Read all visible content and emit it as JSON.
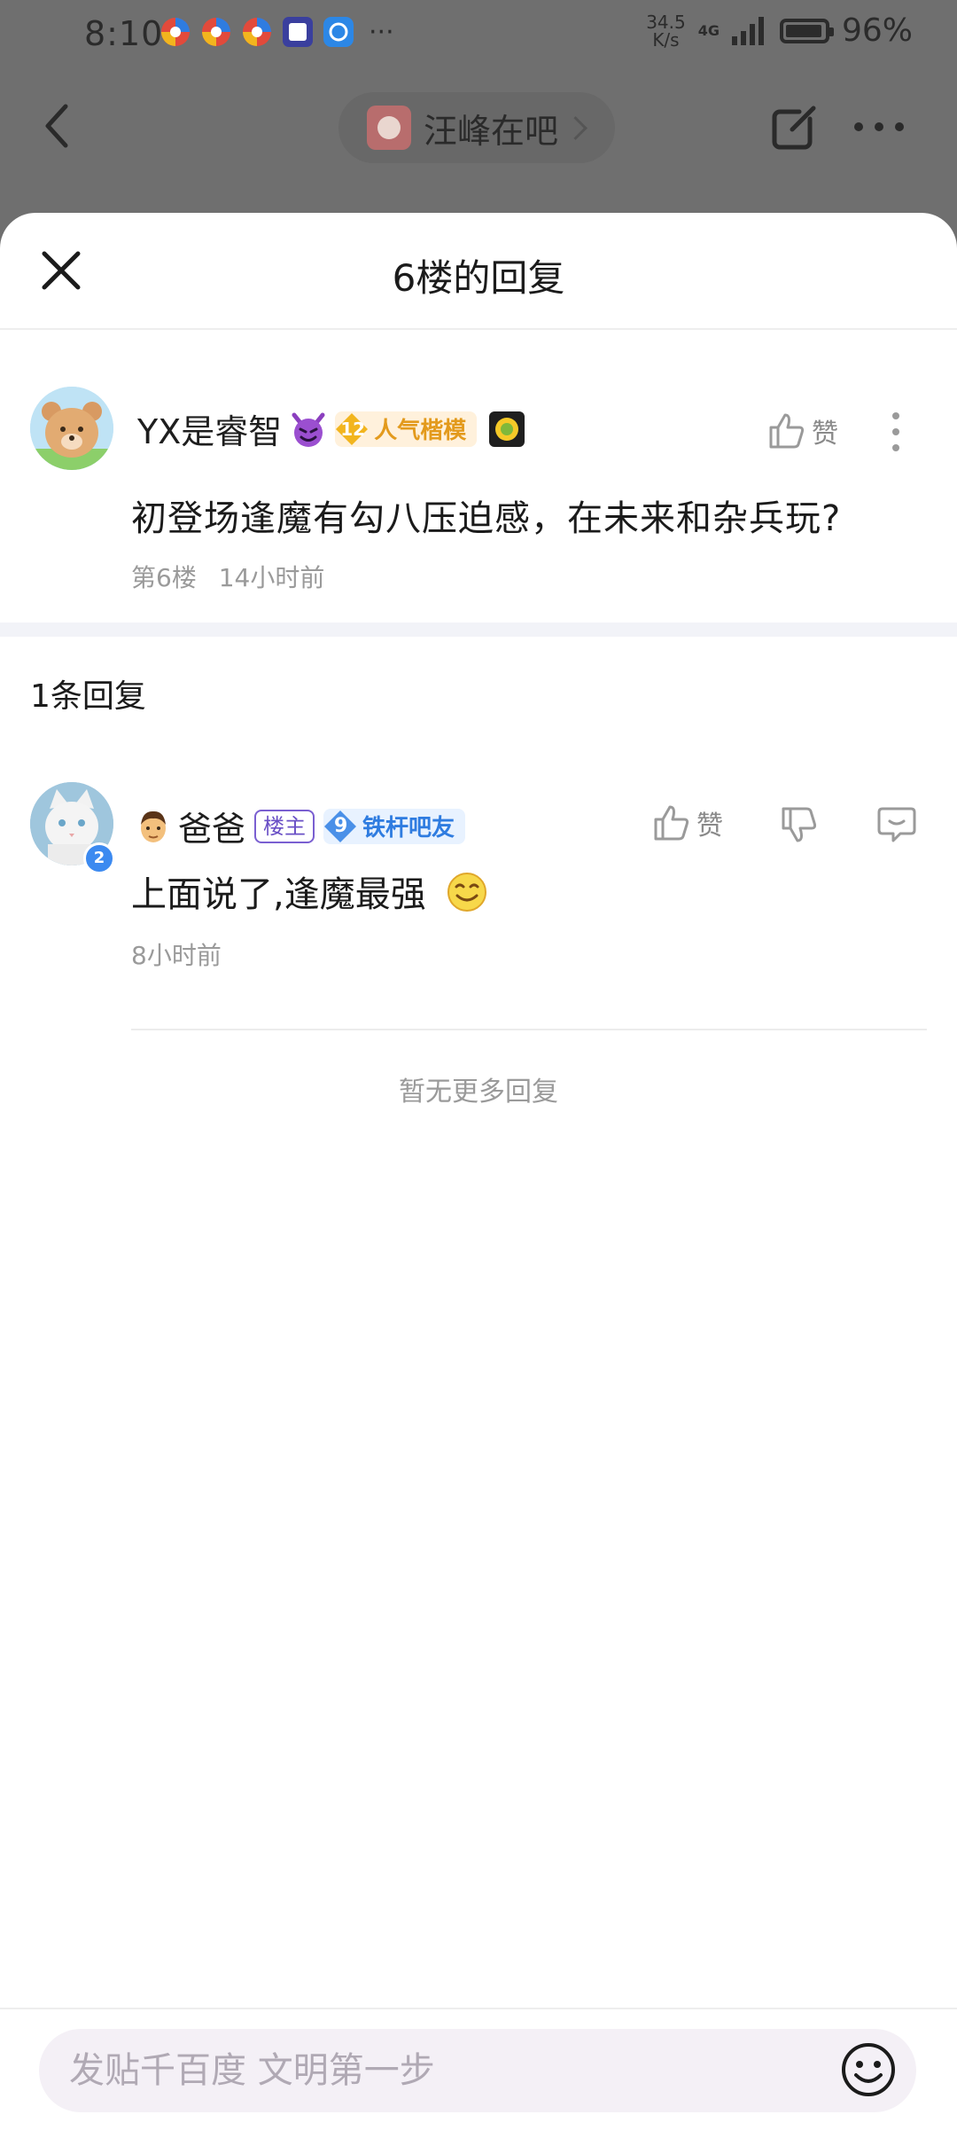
{
  "status_bar": {
    "time": "8:10",
    "net_speed_top": "34.5",
    "net_speed_bottom": "K/s",
    "network": "4G",
    "battery_percent": "96%",
    "battery_level": 0.96
  },
  "nav": {
    "forum_name": "汪峰在吧"
  },
  "sheet": {
    "title": "6楼的回复"
  },
  "post": {
    "username": "YX是睿智",
    "level": "12",
    "badge": "人气楷模",
    "like_label": "赞",
    "content": "初登场逢魔有勾八压迫感，在未来和杂兵玩?",
    "floor": "第6楼",
    "time": "14小时前"
  },
  "replies": {
    "count_label": "1条回复",
    "items": [
      {
        "username": "爸爸",
        "owner_badge": "楼主",
        "level": "9",
        "badge": "铁杆吧友",
        "avatar_level": "2",
        "like_label": "赞",
        "content": "上面说了,逢魔最强",
        "time": "8小时前"
      }
    ],
    "no_more": "暂无更多回复"
  },
  "composer": {
    "placeholder": "发贴千百度 文明第一步"
  },
  "colors": {
    "accent_gold": "#e39a1c",
    "accent_blue": "#2f7ce0",
    "owner_purple": "#6a50c6"
  }
}
